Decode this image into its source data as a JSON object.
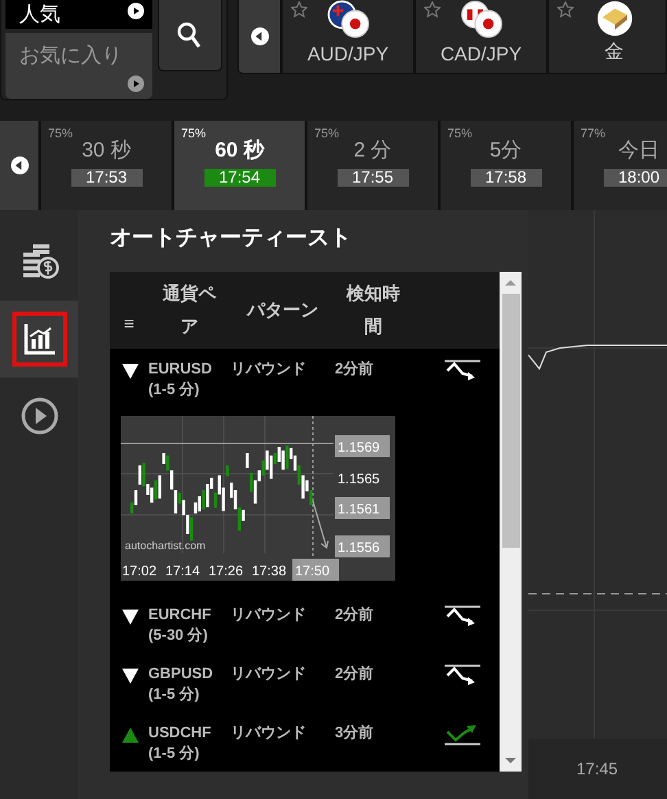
{
  "categories": [
    {
      "label": "人気",
      "selected": true
    },
    {
      "label": "お気に入り",
      "selected": false
    }
  ],
  "assets": [
    {
      "label": "AUD/JPY",
      "kind": "aud"
    },
    {
      "label": "CAD/JPY",
      "kind": "cad"
    },
    {
      "label": "金",
      "kind": "gold"
    }
  ],
  "expiries": [
    {
      "payout": "75%",
      "label": "30 秒",
      "time": "17:53",
      "selected": false
    },
    {
      "payout": "75%",
      "label": "60 秒",
      "time": "17:54",
      "selected": true
    },
    {
      "payout": "75%",
      "label": "2 分",
      "time": "17:55",
      "selected": false
    },
    {
      "payout": "75%",
      "label": "5分",
      "time": "17:58",
      "selected": false
    },
    {
      "payout": "77%",
      "label": "今日",
      "time": "18:00",
      "selected": false
    }
  ],
  "sidebar": [
    {
      "kind": "coins",
      "selected": false
    },
    {
      "kind": "chart",
      "selected": true
    },
    {
      "kind": "play",
      "selected": false
    }
  ],
  "panel": {
    "title": "オートチャーティースト",
    "columns": [
      "≡",
      "通貨ペア",
      "パターン",
      "検知時間"
    ],
    "rows": [
      {
        "kind": "down",
        "pair": "EURUSD",
        "period": "(1-5 分)",
        "pattern": "リバウンド",
        "time": "2分前",
        "expanded": true
      },
      {
        "kind": "down",
        "pair": "EURCHF",
        "period": "(5-30 分)",
        "pattern": "リバウンド",
        "time": "2分前",
        "expanded": false
      },
      {
        "kind": "down",
        "pair": "GBPUSD",
        "period": "(1-5 分)",
        "pattern": "リバウンド",
        "time": "2分前",
        "expanded": false
      },
      {
        "kind": "up",
        "pair": "USDCHF",
        "period": "(1-5 分)",
        "pattern": "リバウンド",
        "time": "3分前",
        "expanded": false
      }
    ],
    "pattern_chart": {
      "price_labels": [
        {
          "text": "1.1569",
          "boxed": true
        },
        {
          "text": "1.1565",
          "boxed": false
        },
        {
          "text": "1.1561",
          "boxed": true
        },
        {
          "text": "1.1556",
          "boxed": true
        }
      ],
      "time_labels": [
        {
          "text": "17:02",
          "selected": false
        },
        {
          "text": "17:14",
          "selected": false
        },
        {
          "text": "17:26",
          "selected": false
        },
        {
          "text": "17:38",
          "selected": false
        },
        {
          "text": "17:50",
          "selected": true
        }
      ],
      "source": "autochartist.com"
    }
  },
  "main_chart": {
    "time_label": "17:45"
  }
}
